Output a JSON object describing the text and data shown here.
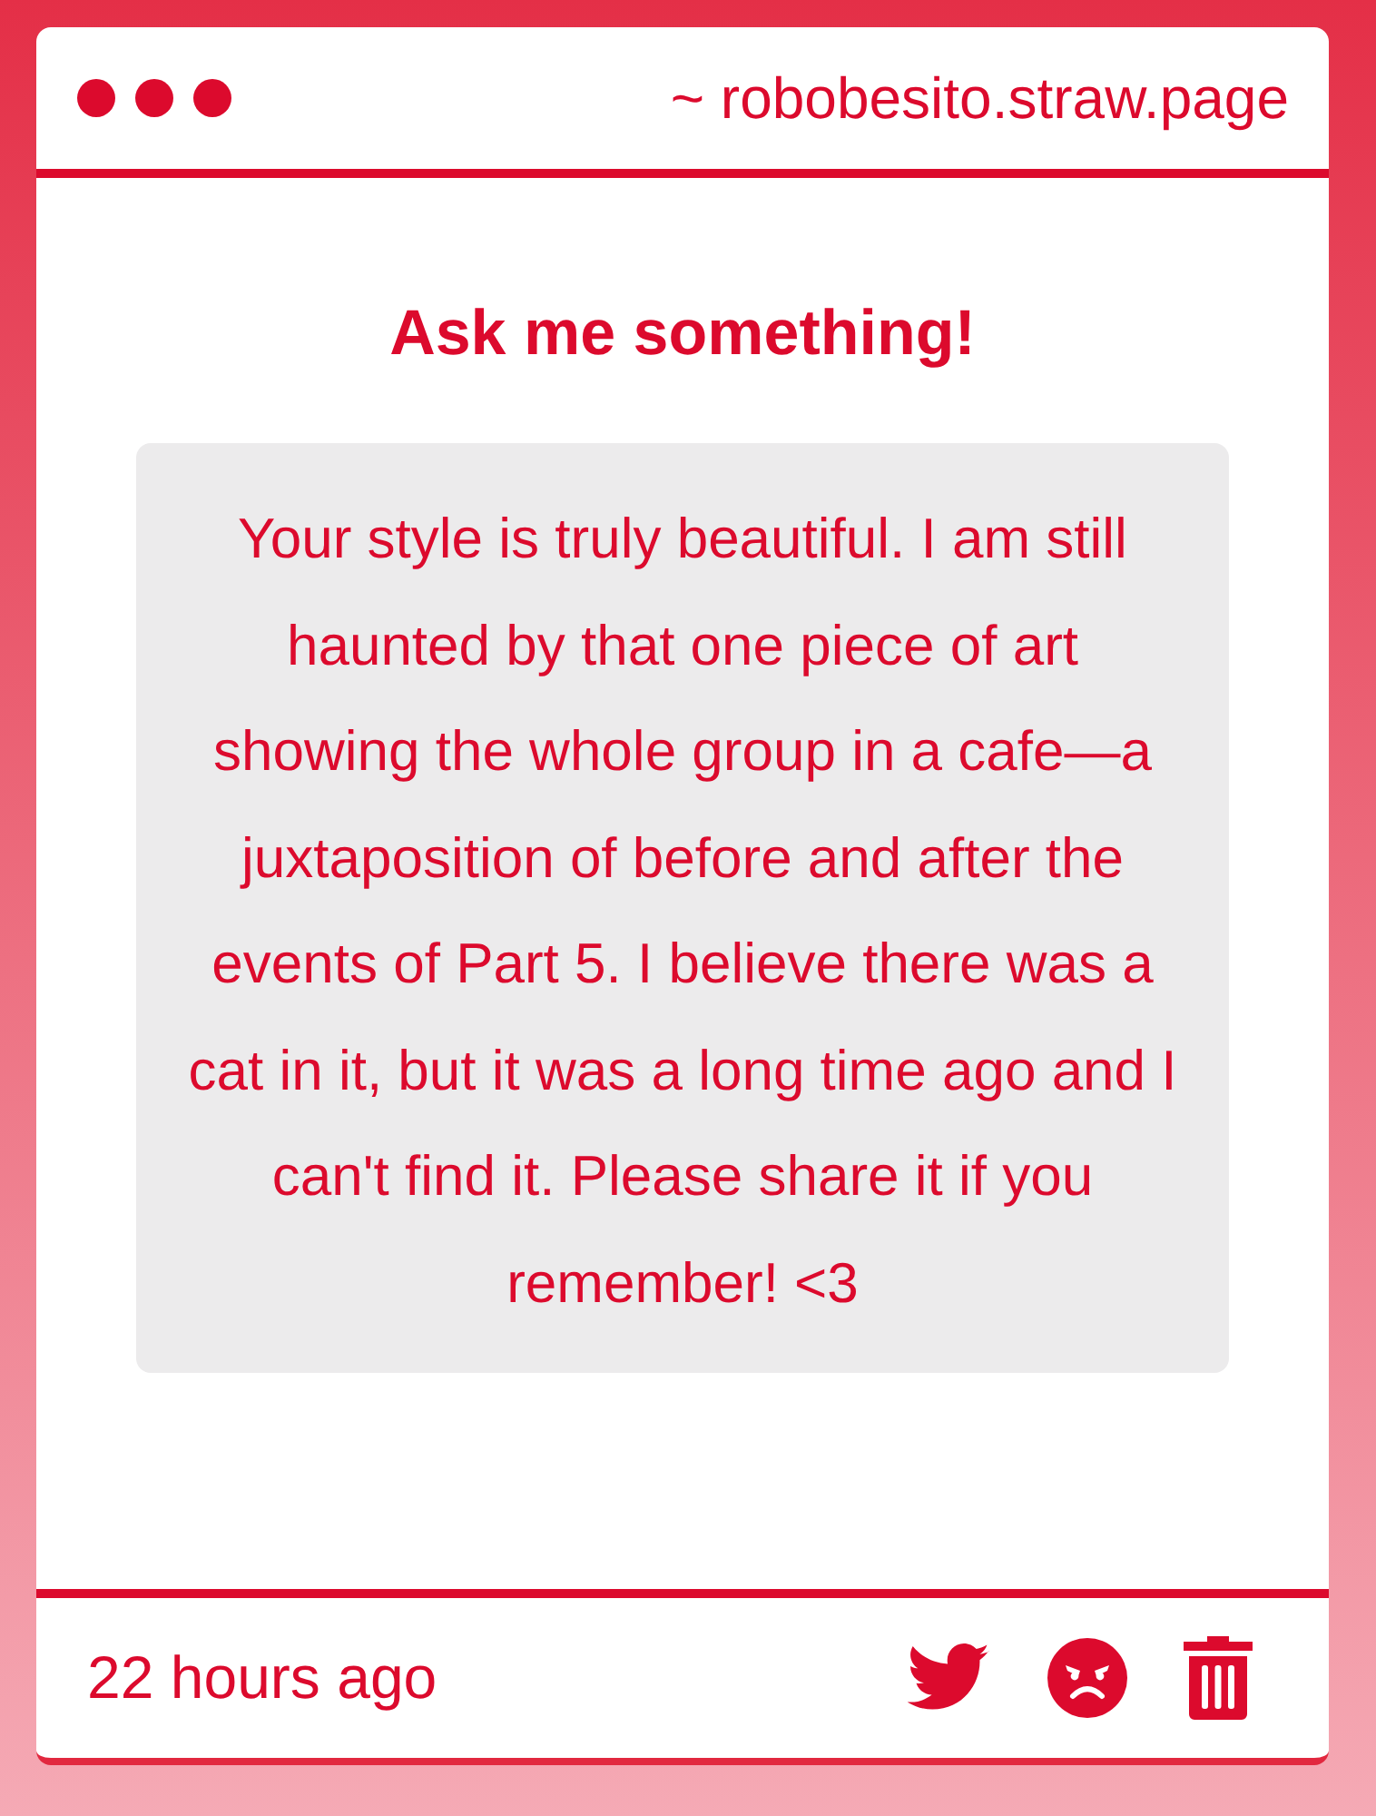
{
  "window": {
    "title": "~ robobesito.straw.page"
  },
  "heading": "Ask me something!",
  "question": "Your style is truly beautiful. I am still haunted by that one piece of art showing the whole group in a cafe—a juxtaposition of before and after the events of Part 5. I believe there was a cat in it, but it was a long time ago and I can't find it. Please share it if you remember! <3",
  "footer": {
    "time": "22 hours ago"
  }
}
